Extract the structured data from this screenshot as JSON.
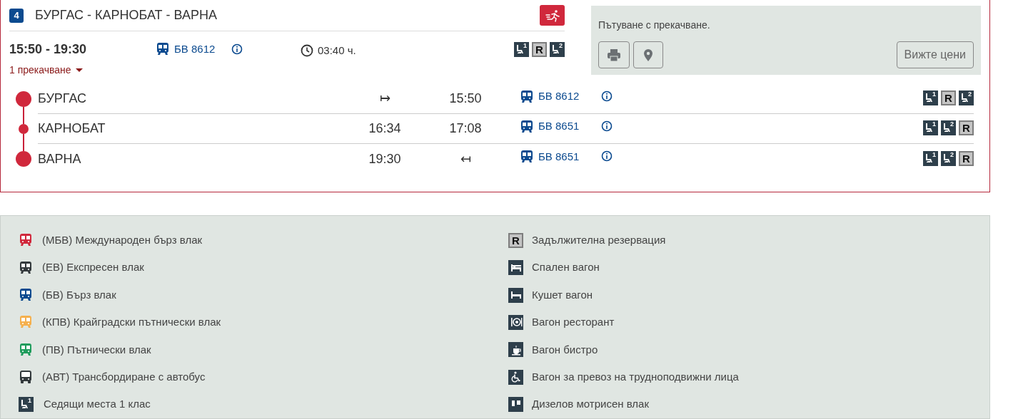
{
  "route": {
    "number": "4",
    "title": "БУРГАС - КАРНОБАТ - ВАРНА",
    "fast": true,
    "times": "15:50 - 19:30",
    "train": {
      "color": "#0b4a8f",
      "label": "БВ 8612"
    },
    "duration": "03:40 ч.",
    "facilities": [
      {
        "kind": "seat",
        "symbol": "1"
      },
      {
        "kind": "reservation",
        "symbol": "R"
      },
      {
        "kind": "seat",
        "symbol": "2"
      }
    ],
    "transfers": "1 прекачване"
  },
  "stops": [
    {
      "station": "БУРГАС",
      "kind": "end",
      "arrival": "↦",
      "departure": "15:50",
      "train": {
        "color": "#0b4a8f",
        "label": "БВ 8612"
      },
      "facilities": [
        {
          "kind": "seat",
          "symbol": "1"
        },
        {
          "kind": "reservation",
          "symbol": "R"
        },
        {
          "kind": "seat",
          "symbol": "2"
        }
      ]
    },
    {
      "station": "КАРНОБАТ",
      "kind": "via",
      "arrival": "16:34",
      "departure": "17:08",
      "train": {
        "color": "#0b4a8f",
        "label": "БВ 8651"
      },
      "facilities": [
        {
          "kind": "seat",
          "symbol": "1"
        },
        {
          "kind": "seat",
          "symbol": "2"
        },
        {
          "kind": "reservation",
          "symbol": "R"
        }
      ]
    },
    {
      "station": "ВАРНА",
      "kind": "end",
      "arrival": "19:30",
      "departure": "↤",
      "train": {
        "color": "#0b4a8f",
        "label": "БВ 8651"
      },
      "facilities": [
        {
          "kind": "seat",
          "symbol": "1"
        },
        {
          "kind": "seat",
          "symbol": "2"
        },
        {
          "kind": "reservation",
          "symbol": "R"
        }
      ]
    }
  ],
  "panel": {
    "note": "Пътуване с прекачване.",
    "prices_button": "Вижте цени"
  },
  "legend": {
    "left": [
      {
        "kind": "train",
        "color": "#d0283c",
        "label": "(МБВ) Международен бърз влак"
      },
      {
        "kind": "train",
        "color": "#33393c",
        "label": "(ЕВ) Експресен влак"
      },
      {
        "kind": "train",
        "color": "#0b4a8f",
        "label": "(БВ) Бърз влак"
      },
      {
        "kind": "train",
        "color": "#f5b04e",
        "label": "(КПВ) Крайградски пътнически влак"
      },
      {
        "kind": "train",
        "color": "#1f9c5c",
        "label": "(ПВ) Пътнически влак"
      },
      {
        "kind": "bus",
        "color": "#33393c",
        "label": "(АВТ) Трансбордиране с автобус"
      },
      {
        "kind": "seat",
        "symbol": "1",
        "label": "Седящи места 1 клас"
      }
    ],
    "right": [
      {
        "kind": "reservation",
        "symbol": "R",
        "label": "Задължителна резервация"
      },
      {
        "kind": "sleeper",
        "label": "Спален вагон"
      },
      {
        "kind": "couchette",
        "label": "Кушет вагон"
      },
      {
        "kind": "restaurant",
        "label": "Вагон ресторант"
      },
      {
        "kind": "bistro",
        "label": "Вагон бистро"
      },
      {
        "kind": "accessible",
        "label": "Вагон за превоз на трудноподвижни лица"
      },
      {
        "kind": "diesel",
        "label": "Дизелов мотрисен влак"
      }
    ]
  }
}
